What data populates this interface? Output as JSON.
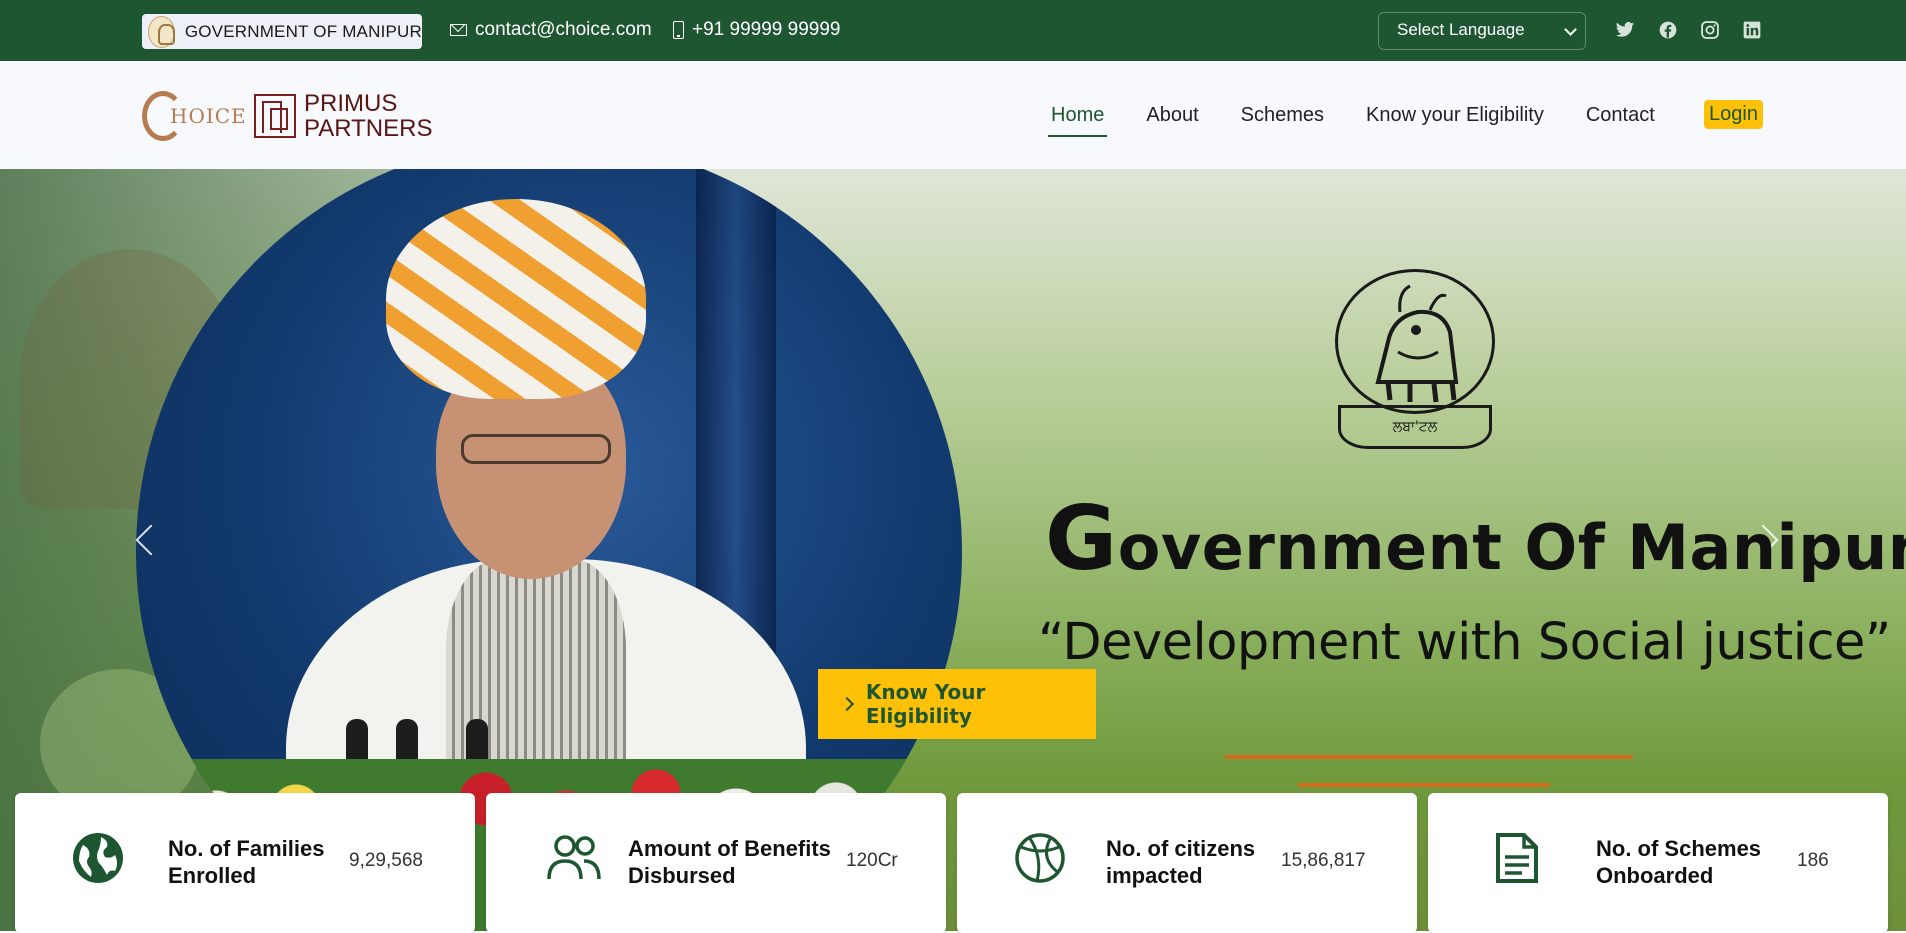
{
  "topbar": {
    "gov_label": "GOVERNMENT OF MANIPUR",
    "email": "contact@choice.com",
    "phone": "+91 99999 99999",
    "language_select": "Select Language",
    "socials": [
      "twitter-icon",
      "facebook-icon",
      "instagram-icon",
      "linkedin-icon"
    ]
  },
  "logos": {
    "choice": "HOICE",
    "primus_line1": "PRIMUS",
    "primus_line2": "PARTNERS"
  },
  "nav": {
    "items": [
      "Home",
      "About",
      "Schemes",
      "Know your Eligibility",
      "Contact"
    ],
    "active": "Home",
    "login": "Login"
  },
  "hero": {
    "title_first": "G",
    "title_rest": "overnment Of Manipur",
    "slogan": "“Development with Social justice”",
    "emblem_text": "ਲਬਾ'ਟਲ",
    "cta": "Know Your Eligibility"
  },
  "stats": [
    {
      "label_line1": "No. of Families",
      "label_line2": "Enrolled",
      "value": "9,29,568",
      "icon": "globe-icon"
    },
    {
      "label_line1": "Amount of Benefits",
      "label_line2": "Disbursed",
      "value": "120Cr",
      "icon": "users-icon"
    },
    {
      "label_line1": "No. of citizens",
      "label_line2": "impacted",
      "value": "15,86,817",
      "icon": "basketball-icon"
    },
    {
      "label_line1": "No. of Schemes",
      "label_line2": "Onboarded",
      "value": "186",
      "icon": "document-icon"
    }
  ],
  "colors": {
    "primary_green": "#1e5631",
    "accent_yellow": "#ffc107",
    "underline_orange": "#d46a1d"
  }
}
